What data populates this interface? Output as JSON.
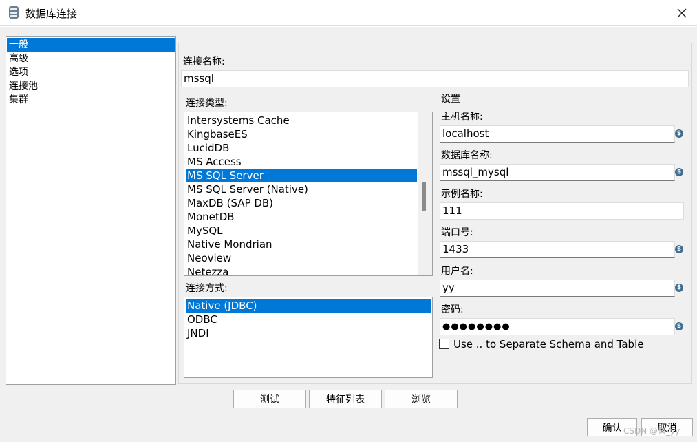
{
  "window": {
    "title": "数据库连接"
  },
  "nav": {
    "items": [
      "一般",
      "高级",
      "选项",
      "连接池",
      "集群"
    ],
    "selected_index": 0
  },
  "general": {
    "connection_name_label": "连接名称:",
    "connection_name_value": "mssql",
    "connection_type_label": "连接类型:",
    "connection_types": [
      "Intersystems Cache",
      "KingbaseES",
      "LucidDB",
      "MS Access",
      "MS SQL Server",
      "MS SQL Server (Native)",
      "MaxDB (SAP DB)",
      "MonetDB",
      "MySQL",
      "Native Mondrian",
      "Neoview",
      "Netezza"
    ],
    "selected_connection_type": "MS SQL Server",
    "access_method_label": "连接方式:",
    "access_methods": [
      "Native (JDBC)",
      "ODBC",
      "JNDI"
    ],
    "selected_access_method": "Native (JDBC)"
  },
  "settings": {
    "group_label": "设置",
    "host_label": "主机名称:",
    "host_value": "localhost",
    "database_label": "数据库名称:",
    "database_value": "mssql_mysql",
    "instance_label": "示例名称:",
    "instance_value": "111",
    "port_label": "端口号:",
    "port_value": "1433",
    "user_label": "用户名:",
    "user_value": "yy",
    "password_label": "密码:",
    "password_value": "●●●●●●●●",
    "variable_icon_glyph": "$",
    "separate_schema_label": "Use .. to Separate Schema and Table",
    "separate_schema_checked": false
  },
  "buttons": {
    "test": "测试",
    "feature_list": "特征列表",
    "explore": "浏览",
    "ok": "确认",
    "cancel": "取消"
  },
  "watermark": "CSDN @曹_yy",
  "colors": {
    "selection": "#0078d7",
    "dialog_background": "#f0f0f0",
    "variable_icon": "#3f6d8f"
  }
}
